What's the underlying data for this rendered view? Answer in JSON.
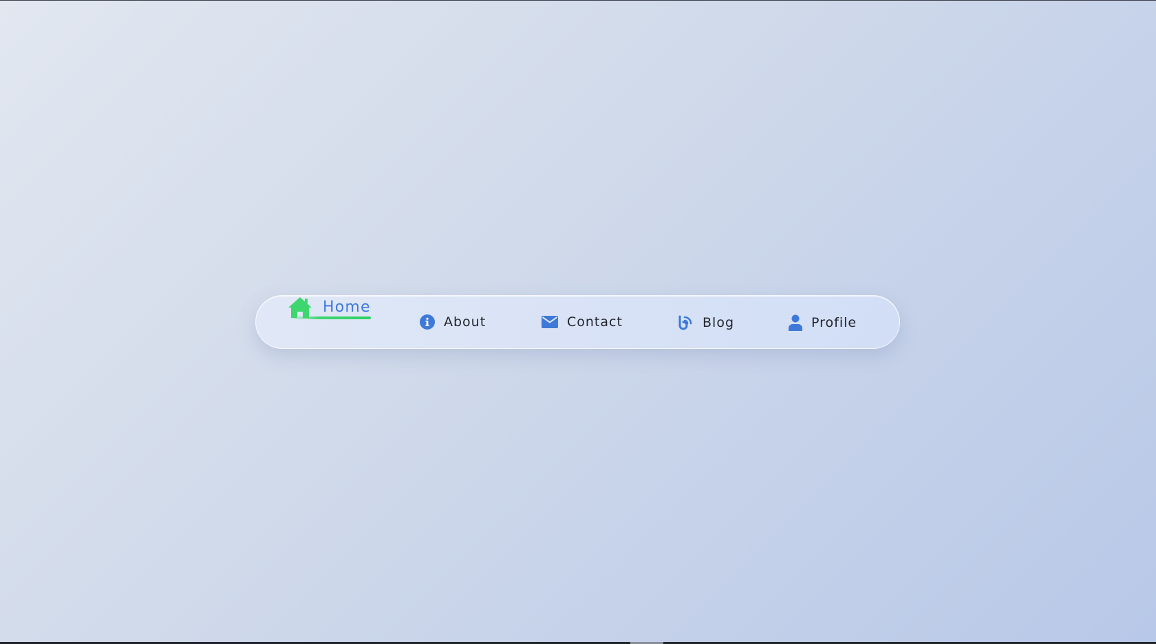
{
  "nav": {
    "items": [
      {
        "label": "Home",
        "icon": "home-icon",
        "active": true
      },
      {
        "label": "About",
        "icon": "info-icon",
        "active": false
      },
      {
        "label": "Contact",
        "icon": "envelope-icon",
        "active": false
      },
      {
        "label": "Blog",
        "icon": "blog-icon",
        "active": false
      },
      {
        "label": "Profile",
        "icon": "user-icon",
        "active": false
      }
    ]
  },
  "colors": {
    "accent": "#3e79d8",
    "active_icon": "#3ed66e",
    "text": "#22252c",
    "background_start": "#e2e7f0",
    "background_end": "#b8c8e8"
  }
}
